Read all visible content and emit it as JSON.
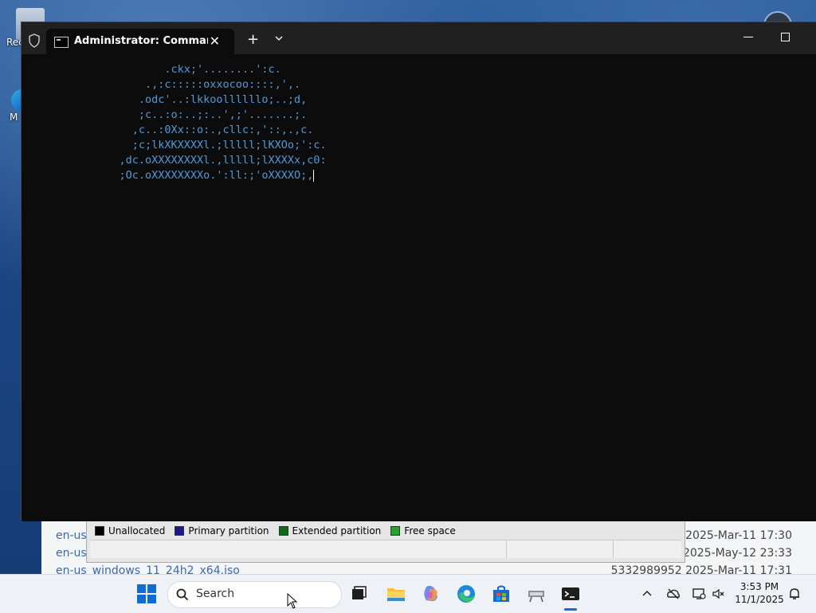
{
  "desktop": {
    "icons": [
      {
        "caption": "Rec"
      },
      {
        "caption": "M"
      }
    ]
  },
  "file_list": {
    "rows": [
      {
        "name": "en-us",
        "meta": "2025-Mar-11 17:30"
      },
      {
        "name": "en-us",
        "meta": "2025-May-12 23:33"
      },
      {
        "name": "en-us_windows_11_24h2_x64.iso",
        "meta": "5332989952 2025-Mar-11 17:31"
      }
    ]
  },
  "disk_legend": {
    "items": [
      {
        "label": "Unallocated",
        "color": "#000000"
      },
      {
        "label": "Primary partition",
        "color": "#1a1a8c"
      },
      {
        "label": "Extended partition",
        "color": "#0e6b16"
      },
      {
        "label": "Free space",
        "color": "#22a32a"
      }
    ]
  },
  "terminal": {
    "tab_title": "Administrator: Command Pro",
    "new_tab_label": "+",
    "close_label": "✕",
    "output_lines": [
      "           .ckx;'........':c.",
      "        .,:c:::::oxxocoo::::,',.",
      "       .odc'..:lkkoollllllo;..;d,",
      "       ;c..:o:..;:..',;'.......;.",
      "      ,c..:0Xx::o:.,cllc:,'::,.,c.",
      "      ;c;lkXKXXXXl.;lllll;lKXOo;':c.",
      "    ,dc.oXXXXXXXXl.,lllll;lXXXXx,c0:",
      "    ;Oc.oXXXXXXXXo.':ll:;'oXXXXO;,"
    ]
  },
  "taskbar": {
    "search_placeholder": "Search",
    "apps": [
      {
        "icon": "task-view-icon"
      },
      {
        "icon": "file-explorer-icon"
      },
      {
        "icon": "copilot-icon"
      },
      {
        "icon": "edge-icon"
      },
      {
        "icon": "store-icon"
      },
      {
        "icon": "network-tool-icon"
      },
      {
        "icon": "terminal-icon",
        "active": true
      }
    ],
    "tray": {
      "time": "3:53 PM",
      "date": "11/1/2025"
    }
  }
}
